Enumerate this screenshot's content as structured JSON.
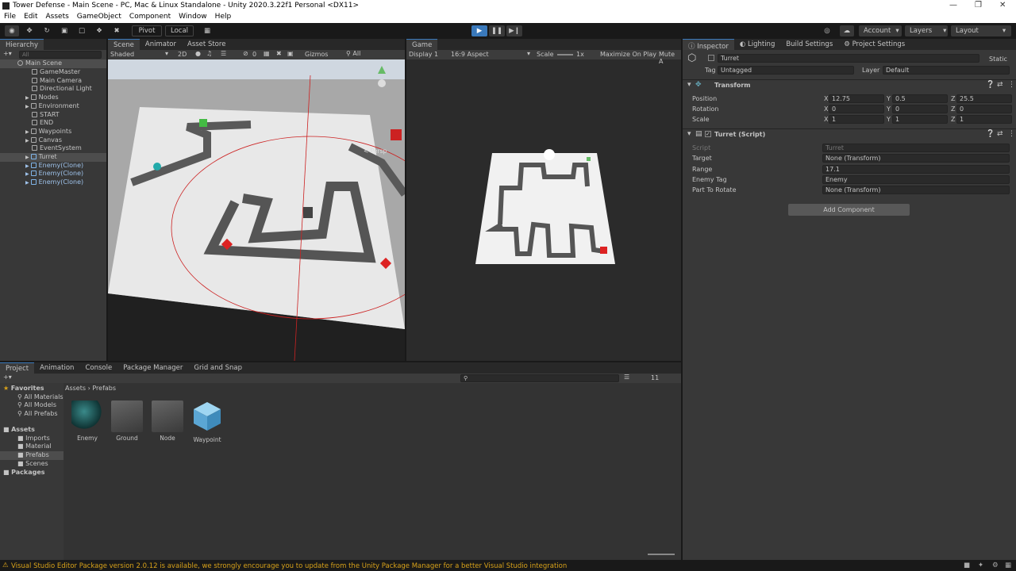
{
  "window": {
    "title": "Tower Defense - Main Scene - PC, Mac & Linux Standalone - Unity 2020.3.22f1 Personal <DX11>",
    "minimize": "—",
    "maximize": "❐",
    "close": "✕"
  },
  "menu": [
    "File",
    "Edit",
    "Assets",
    "GameObject",
    "Component",
    "Window",
    "Help"
  ],
  "toolbar": {
    "pivot": "Pivot",
    "local": "Local",
    "account": "Account",
    "layers": "Layers",
    "layout": "Layout"
  },
  "hierarchy": {
    "tab": "Hierarchy",
    "search_placeholder": "All",
    "scene": "Main Scene",
    "items": [
      "GameMaster",
      "Main Camera",
      "Directional Light",
      "Nodes",
      "Environment",
      "START",
      "END",
      "Waypoints",
      "Canvas",
      "EventSystem",
      "Turret",
      "Enemy(Clone)",
      "Enemy(Clone)",
      "Enemy(Clone)"
    ]
  },
  "scene_view": {
    "tabs": [
      "Scene",
      "Animator",
      "Asset Store"
    ],
    "shading": "Shaded",
    "mode_2d": "2D",
    "gizmos": "Gizmos",
    "search_placeholder": "All",
    "fx_count": "0",
    "persp": "< Persp"
  },
  "game_view": {
    "tab": "Game",
    "display": "Display 1",
    "aspect": "16:9 Aspect",
    "scale_label": "Scale",
    "scale_value": "1x",
    "maximize": "Maximize On Play",
    "mute": "Mute A"
  },
  "inspector": {
    "tabs": [
      "Inspector",
      "Lighting",
      "Build Settings",
      "Project Settings"
    ],
    "object_name": "Turret",
    "static": "Static",
    "tag_label": "Tag",
    "tag_value": "Untagged",
    "layer_label": "Layer",
    "layer_value": "Default",
    "transform": {
      "title": "Transform",
      "position": {
        "label": "Position",
        "x": "12.75",
        "y": "0.5",
        "z": "25.5"
      },
      "rotation": {
        "label": "Rotation",
        "x": "0",
        "y": "0",
        "z": "0"
      },
      "scale": {
        "label": "Scale",
        "x": "1",
        "y": "1",
        "z": "1"
      }
    },
    "script": {
      "title": "Turret (Script)",
      "script_label": "Script",
      "script_value": "Turret",
      "target_label": "Target",
      "target_value": "None (Transform)",
      "range_label": "Range",
      "range_value": "17.1",
      "enemy_tag_label": "Enemy Tag",
      "enemy_tag_value": "Enemy",
      "part_label": "Part To Rotate",
      "part_value": "None (Transform)"
    },
    "add_component": "Add Component"
  },
  "project": {
    "tabs": [
      "Project",
      "Animation",
      "Console",
      "Package Manager",
      "Grid and Snap"
    ],
    "favorites": "Favorites",
    "fav_items": [
      "All Materials",
      "All Models",
      "All Prefabs"
    ],
    "assets": "Assets",
    "asset_folders": [
      "Imports",
      "Material",
      "Prefabs",
      "Scenes"
    ],
    "packages": "Packages",
    "breadcrumb": [
      "Assets",
      "Prefabs"
    ],
    "hidden_count": "11",
    "items": [
      "Enemy",
      "Ground",
      "Node",
      "Waypoint"
    ]
  },
  "status": "Visual Studio Editor Package version 2.0.12 is available, we strongly encourage you to update from the Unity Package Manager for a better Visual Studio integration",
  "colors": {
    "accent": "#3a79bb",
    "panel": "#383838",
    "tab_bar": "#282828",
    "warning": "#d8a21a"
  }
}
